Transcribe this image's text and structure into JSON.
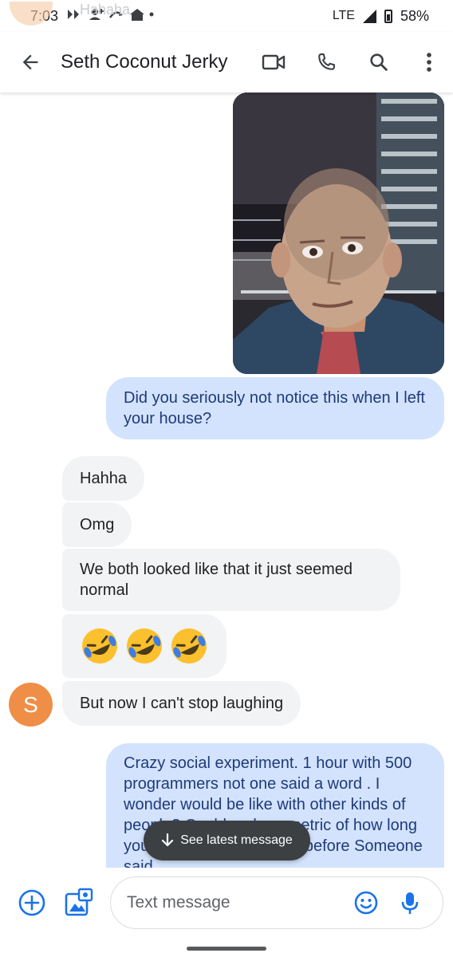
{
  "status_bar": {
    "time": "7:03",
    "network": "LTE",
    "battery": "58%"
  },
  "header": {
    "contact_name": "Seth Coconut Jerky",
    "ghost_text": "Hahaha",
    "icons": [
      "back-arrow-icon",
      "video-call-icon",
      "phone-icon",
      "search-icon",
      "more-vert-icon"
    ]
  },
  "messages": [
    {
      "type": "image",
      "direction": "outgoing",
      "description": "selfie photo"
    },
    {
      "type": "text",
      "direction": "outgoing",
      "text": "Did you seriously not notice this when I left your house?"
    },
    {
      "type": "text",
      "direction": "incoming",
      "text": "Hahha"
    },
    {
      "type": "text",
      "direction": "incoming",
      "text": "Omg"
    },
    {
      "type": "text",
      "direction": "incoming",
      "text": "We both looked like that it just seemed normal"
    },
    {
      "type": "emoji",
      "direction": "incoming",
      "text": "🤣🤣🤣"
    },
    {
      "type": "text",
      "direction": "incoming",
      "text": "But now I can't stop laughing"
    },
    {
      "type": "text",
      "direction": "outgoing",
      "text": "Crazy social experiment. 1 hour with 500 programmers not one said a word . I wonder would be like with other kinds of people? Could make a metric of how long you can spend in a place before Someone said"
    }
  ],
  "sender_avatar": {
    "initial": "S",
    "color": "#ef8e47"
  },
  "latest_pill": {
    "label": "See latest message"
  },
  "compose": {
    "placeholder": "Text message",
    "icons": [
      "add-circle-icon",
      "gallery-icon",
      "emoji-icon",
      "microphone-icon"
    ]
  },
  "colors": {
    "outgoing_bubble": "#d3e3fd",
    "outgoing_text": "#1f3a7a",
    "incoming_bubble": "#f1f3f4",
    "accent": "#1a73e8"
  }
}
